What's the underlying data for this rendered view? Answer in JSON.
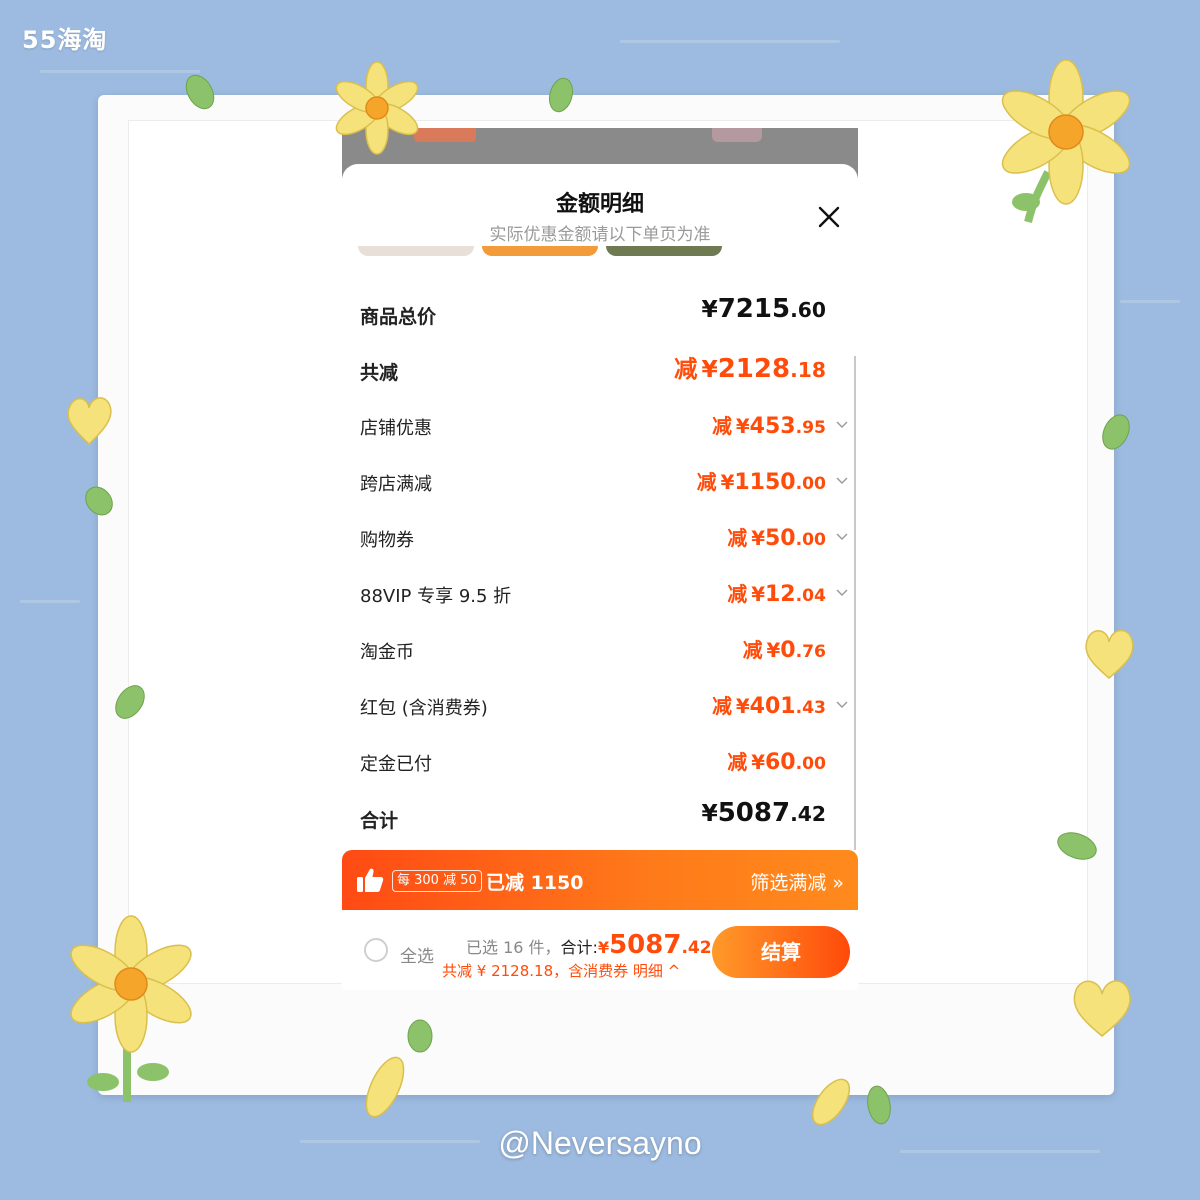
{
  "watermarks": {
    "top_left": "55海淘",
    "bottom": "@Neversayno"
  },
  "sheet": {
    "title": "金额明细",
    "subtitle": "实际优惠金额请以下单页为准",
    "rows": [
      {
        "label": "商品总价",
        "prefix": "",
        "yen": "¥",
        "int": "7215",
        "dec": ".60",
        "style": "plain-major"
      },
      {
        "label": "共减",
        "prefix": "减",
        "yen": "¥",
        "int": "2128",
        "dec": ".18",
        "style": "major"
      },
      {
        "label": "店铺优惠",
        "prefix": "减",
        "yen": "¥",
        "int": "453",
        "dec": ".95",
        "chevron": true
      },
      {
        "label": "跨店满减",
        "prefix": "减",
        "yen": "¥",
        "int": "1150",
        "dec": ".00",
        "chevron": true
      },
      {
        "label": "购物券",
        "prefix": "减",
        "yen": "¥",
        "int": "50",
        "dec": ".00",
        "chevron": true
      },
      {
        "label": "88VIP 专享 9.5 折",
        "prefix": "减",
        "yen": "¥",
        "int": "12",
        "dec": ".04",
        "chevron": true
      },
      {
        "label": "淘金币",
        "prefix": "减",
        "yen": "¥",
        "int": "0",
        "dec": ".76",
        "chevron": false
      },
      {
        "label": "红包 (含消费券)",
        "prefix": "减",
        "yen": "¥",
        "int": "401",
        "dec": ".43",
        "chevron": true
      },
      {
        "label": "定金已付",
        "prefix": "减",
        "yen": "¥",
        "int": "60",
        "dec": ".00",
        "chevron": false
      },
      {
        "label": "合计",
        "prefix": "",
        "yen": "¥",
        "int": "5087",
        "dec": ".42",
        "style": "plain-major"
      }
    ]
  },
  "promo": {
    "tag": "每 300 减 50",
    "text": "已减 1150",
    "link": "筛选满减 »"
  },
  "checkout": {
    "select_all": "全选",
    "selected_count": "已选 16 件，",
    "total_label": "合计:",
    "yen": "¥",
    "total_int": "5087",
    "total_dec": ".42",
    "discount_line": "共减 ¥ 2128.18，含消费券  明细 ^",
    "button": "结算"
  },
  "colors": {
    "accent": "#ff4c0a",
    "background": "#9dbbe0",
    "flower": "#f6e27a",
    "leaf": "#8cc26a"
  }
}
